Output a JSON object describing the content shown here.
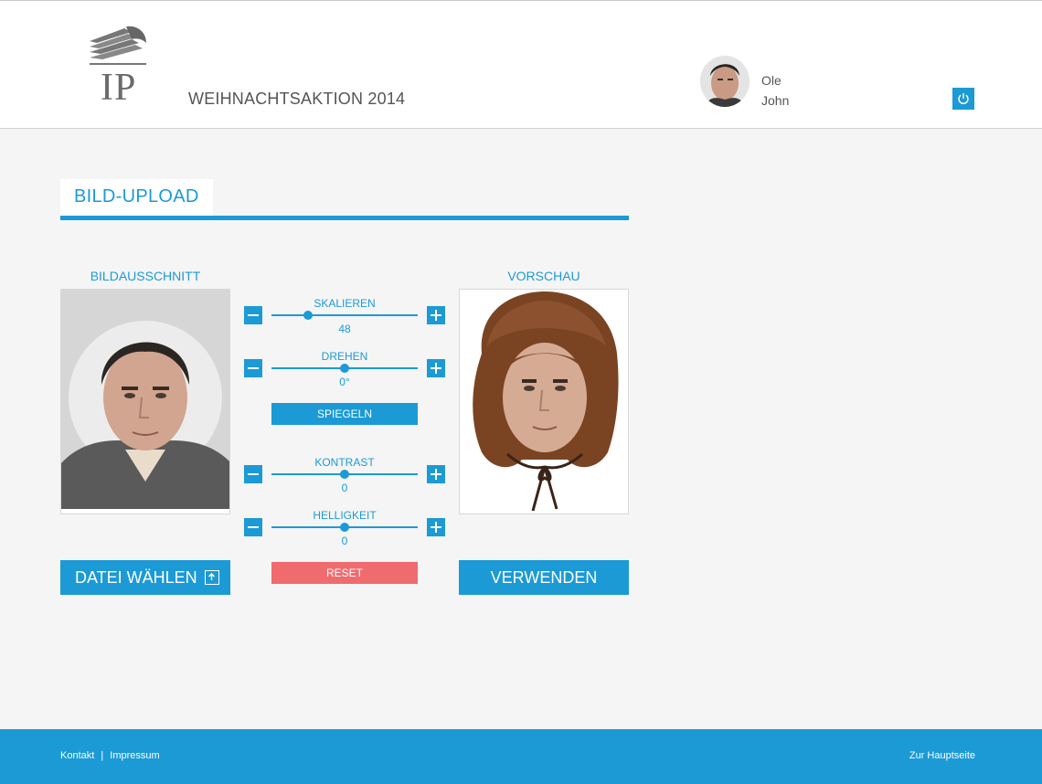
{
  "header": {
    "logo_text": "IP",
    "title": "WEIHNACHTSAKTION 2014",
    "user": {
      "first_name": "Ole",
      "last_name": "John"
    },
    "power_icon": "power-icon"
  },
  "section": {
    "title": "BILD-UPLOAD"
  },
  "crop": {
    "heading": "BILDAUSSCHNITT",
    "choose_file_label": "DATEI WÄHLEN",
    "upload_icon": "upload-icon"
  },
  "preview": {
    "heading": "VORSCHAU",
    "use_label": "VERWENDEN"
  },
  "controls": {
    "scale": {
      "label": "SKALIEREN",
      "value": "48",
      "level": 0.25
    },
    "rotate": {
      "label": "DREHEN",
      "value": "0°",
      "level": 0.5
    },
    "mirror_label": "SPIEGELN",
    "contrast": {
      "label": "KONTRAST",
      "value": "0",
      "level": 0.5
    },
    "brightness": {
      "label": "HELLIGKEIT",
      "value": "0",
      "level": 0.5
    },
    "reset_label": "RESET"
  },
  "footer": {
    "contact": "Kontakt",
    "separator": "|",
    "imprint": "Impressum",
    "home": "Zur Hauptseite"
  },
  "colors": {
    "accent": "#1b9ad6",
    "reset": "#ef6b6e",
    "background": "#f5f5f5"
  }
}
